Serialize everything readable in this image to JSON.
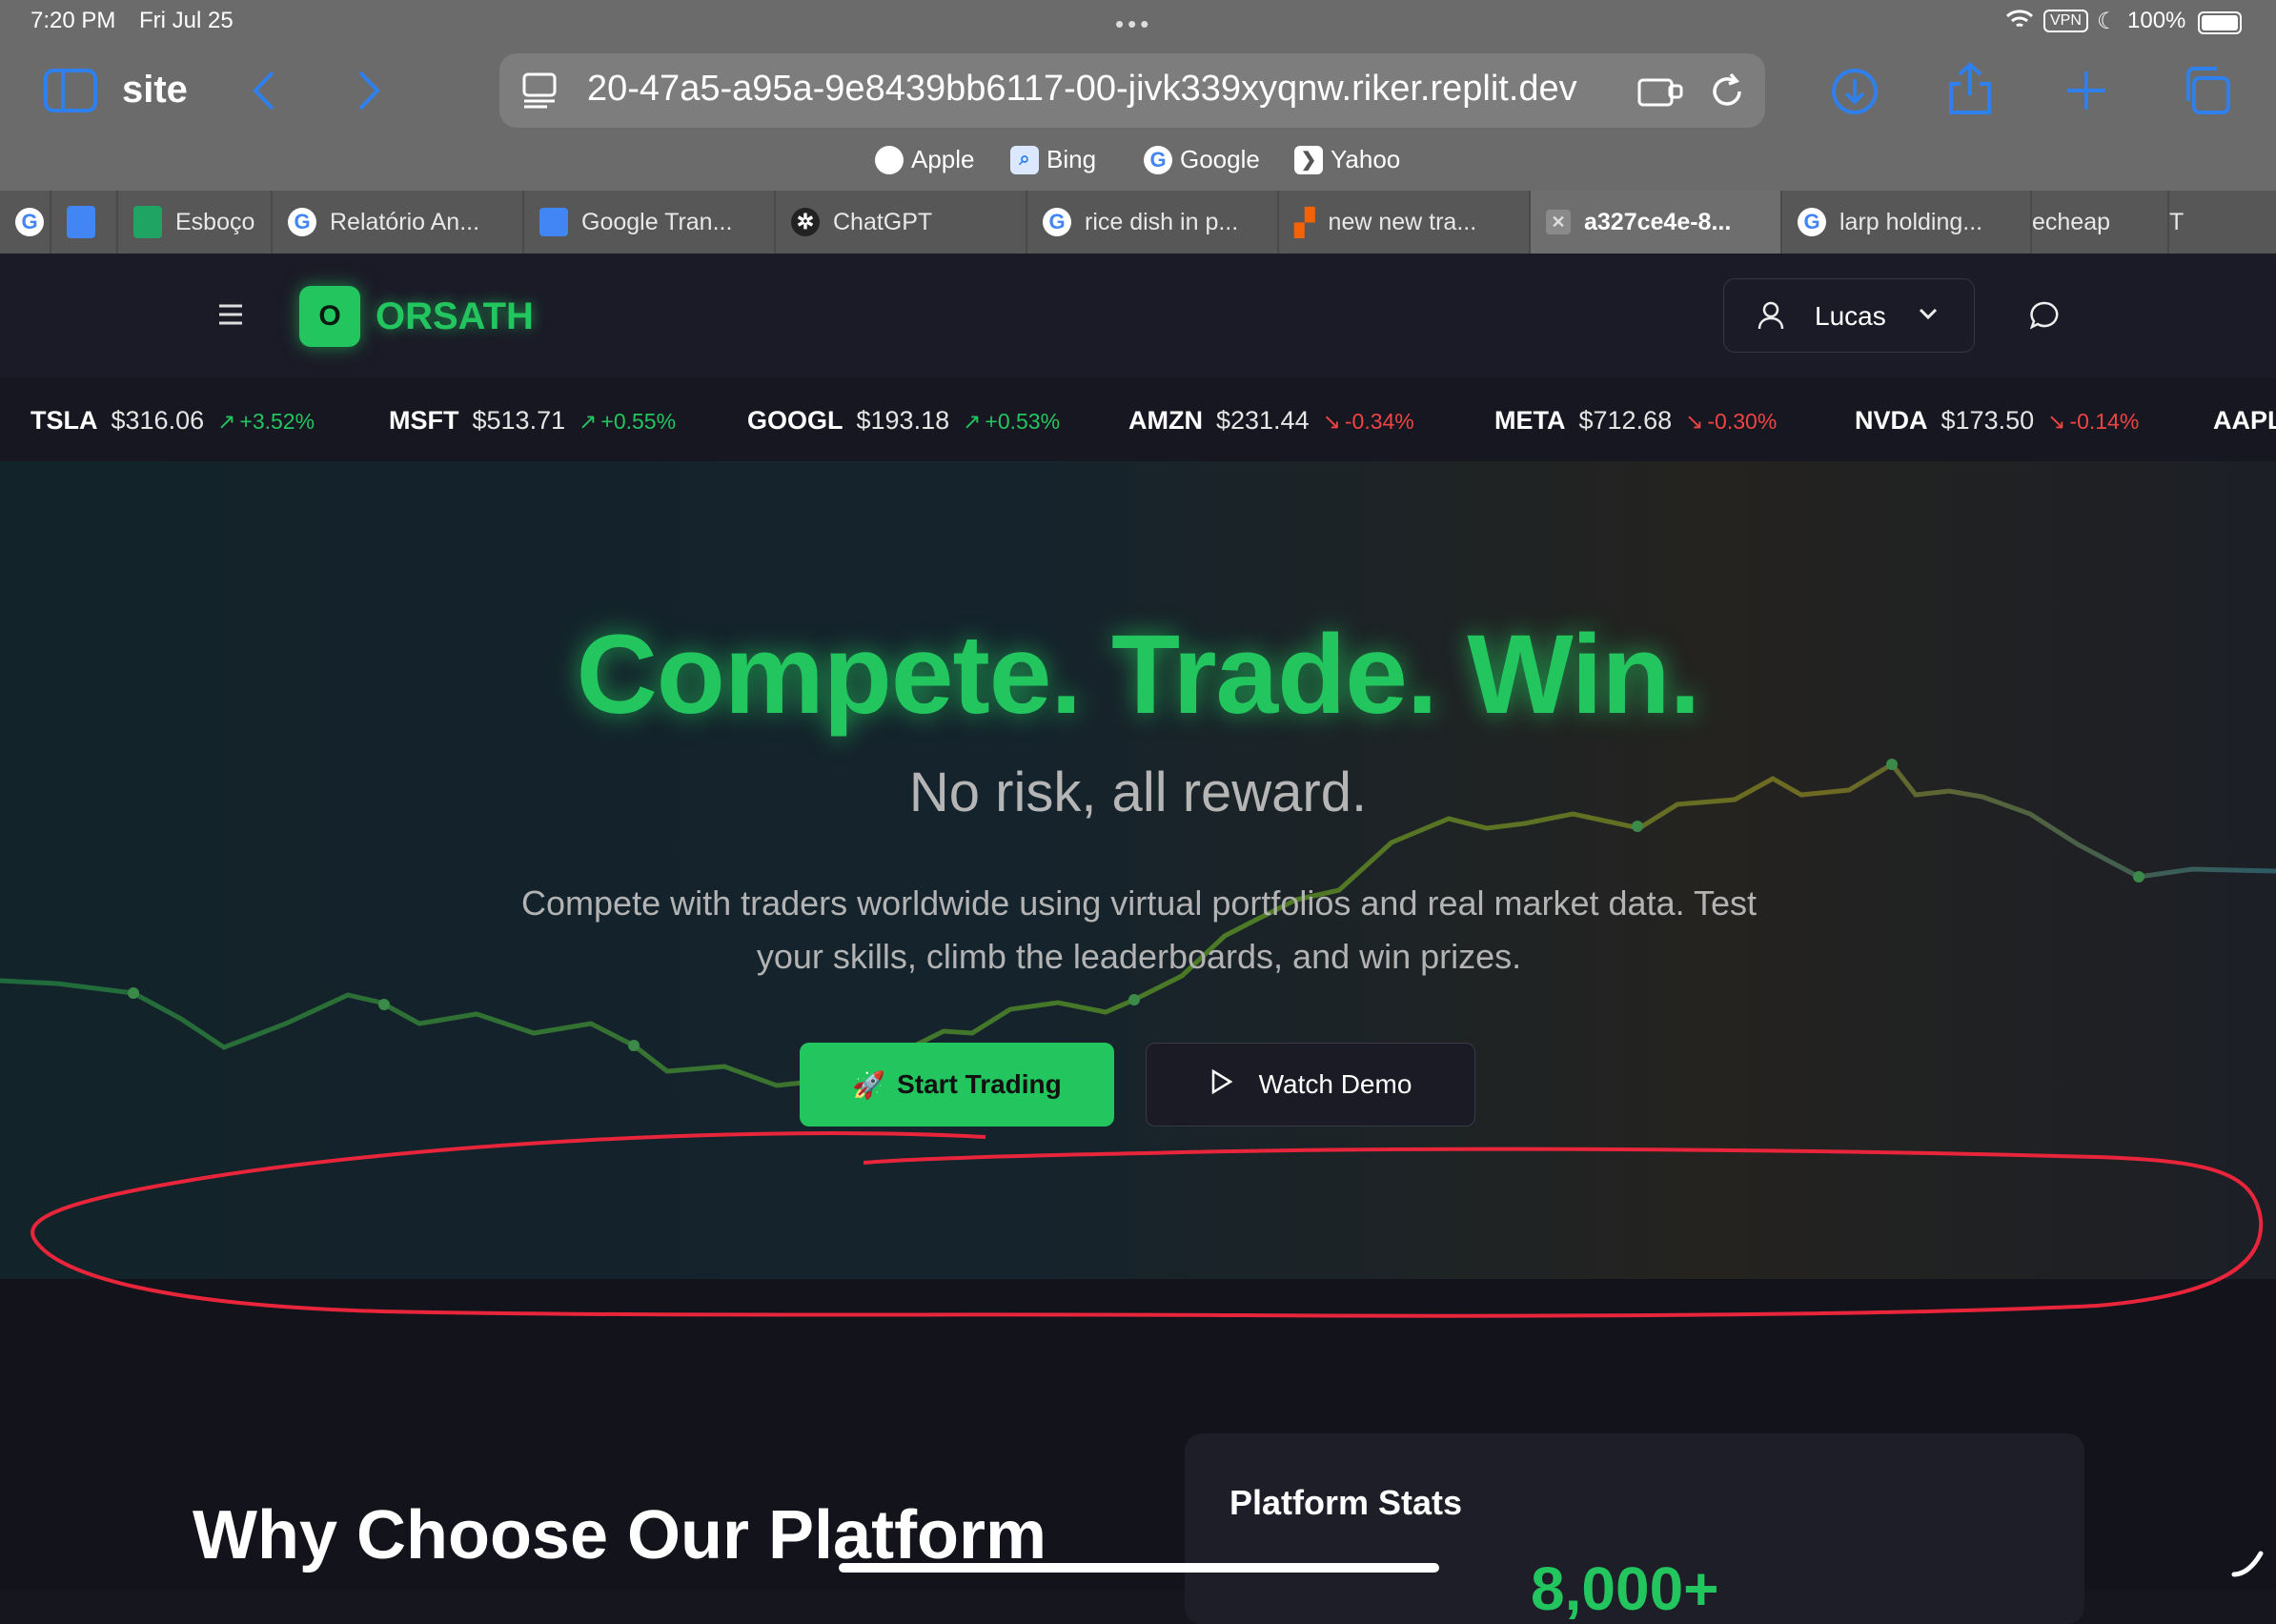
{
  "status_bar": {
    "time": "7:20 PM",
    "date": "Fri Jul 25",
    "vpn": "VPN",
    "battery": "100%"
  },
  "browser": {
    "sidebar_label": "site",
    "address": "20-47a5-a95a-9e8439bb6117-00-jivk339xyqnw.riker.replit.dev",
    "favorites": [
      "Apple",
      "Bing",
      "Google",
      "Yahoo"
    ],
    "tabs": [
      "Esboço",
      "Relatório An...",
      "Google Tran...",
      "ChatGPT",
      "rice dish in p...",
      "new new tra...",
      "a327ce4e-8...",
      "larp holding...",
      "echeap",
      "T"
    ]
  },
  "site": {
    "logo_letter": "O",
    "brand": "ORSATH",
    "user_name": "Lucas",
    "ticker": [
      {
        "symbol": "TSLA",
        "price": "$316.06",
        "change": "+3.52%",
        "dir": "up"
      },
      {
        "symbol": "MSFT",
        "price": "$513.71",
        "change": "+0.55%",
        "dir": "up"
      },
      {
        "symbol": "GOOGL",
        "price": "$193.18",
        "change": "+0.53%",
        "dir": "up"
      },
      {
        "symbol": "AMZN",
        "price": "$231.44",
        "change": "-0.34%",
        "dir": "down"
      },
      {
        "symbol": "META",
        "price": "$712.68",
        "change": "-0.30%",
        "dir": "down"
      },
      {
        "symbol": "NVDA",
        "price": "$173.50",
        "change": "-0.14%",
        "dir": "down"
      },
      {
        "symbol": "AAPL",
        "price": "",
        "change": "",
        "dir": ""
      }
    ],
    "hero": {
      "headline": "Compete. Trade. Win.",
      "subheadline": "No risk, all reward.",
      "description": "Compete with traders worldwide using virtual portfolios and real market data. Test your skills, climb the leaderboards, and win prizes.",
      "start_button": "Start Trading",
      "demo_button": "Watch Demo"
    },
    "why_heading": "Why Choose Our Platform",
    "stats_title": "Platform Stats",
    "stats_number": "8,000+"
  },
  "colors": {
    "accent": "#22c55e",
    "down": "#ef4444",
    "annotation": "#e8253a"
  }
}
